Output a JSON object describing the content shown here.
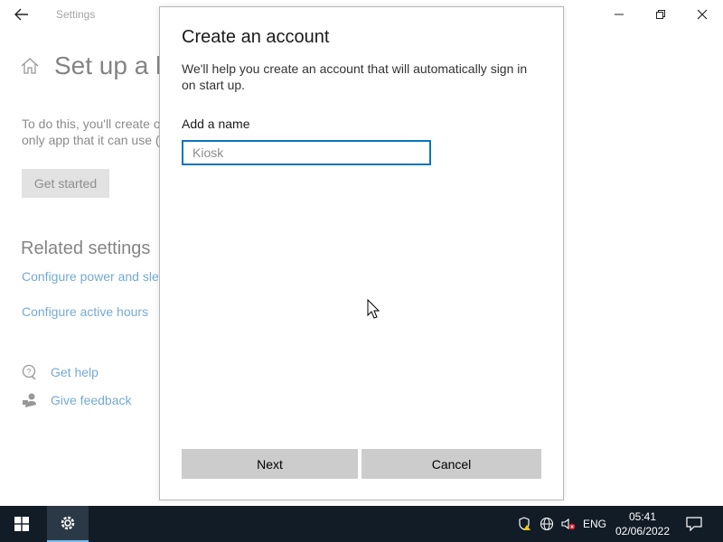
{
  "settings_window": {
    "title": "Settings",
    "page_title": "Set up a k",
    "description_line1": "To do this, you'll create o",
    "description_line2": "only app that it can use (",
    "get_started": "Get started",
    "related_heading": "Related settings",
    "links": [
      "Configure power and sle",
      "Configure active hours"
    ],
    "get_help": "Get help",
    "give_feedback": "Give feedback"
  },
  "dialog": {
    "title": "Create an account",
    "description": "We'll help you create an account that will automatically sign in on start up.",
    "name_label": "Add a name",
    "name_placeholder": "Kiosk",
    "name_value": "",
    "next_label": "Next",
    "cancel_label": "Cancel"
  },
  "taskbar": {
    "language": "ENG",
    "time": "05:41",
    "date": "02/06/2022"
  },
  "colors": {
    "accent": "#0a74c0",
    "link": "#0063b1",
    "taskbar": "#111c27",
    "button": "#cccccc"
  },
  "icons": [
    "back-arrow-icon",
    "home-icon",
    "minimize-icon",
    "restore-icon",
    "close-icon",
    "help-icon",
    "feedback-icon",
    "windows-start-icon",
    "gear-icon",
    "security-warning-icon",
    "network-icon",
    "volume-muted-icon",
    "notification-icon"
  ]
}
